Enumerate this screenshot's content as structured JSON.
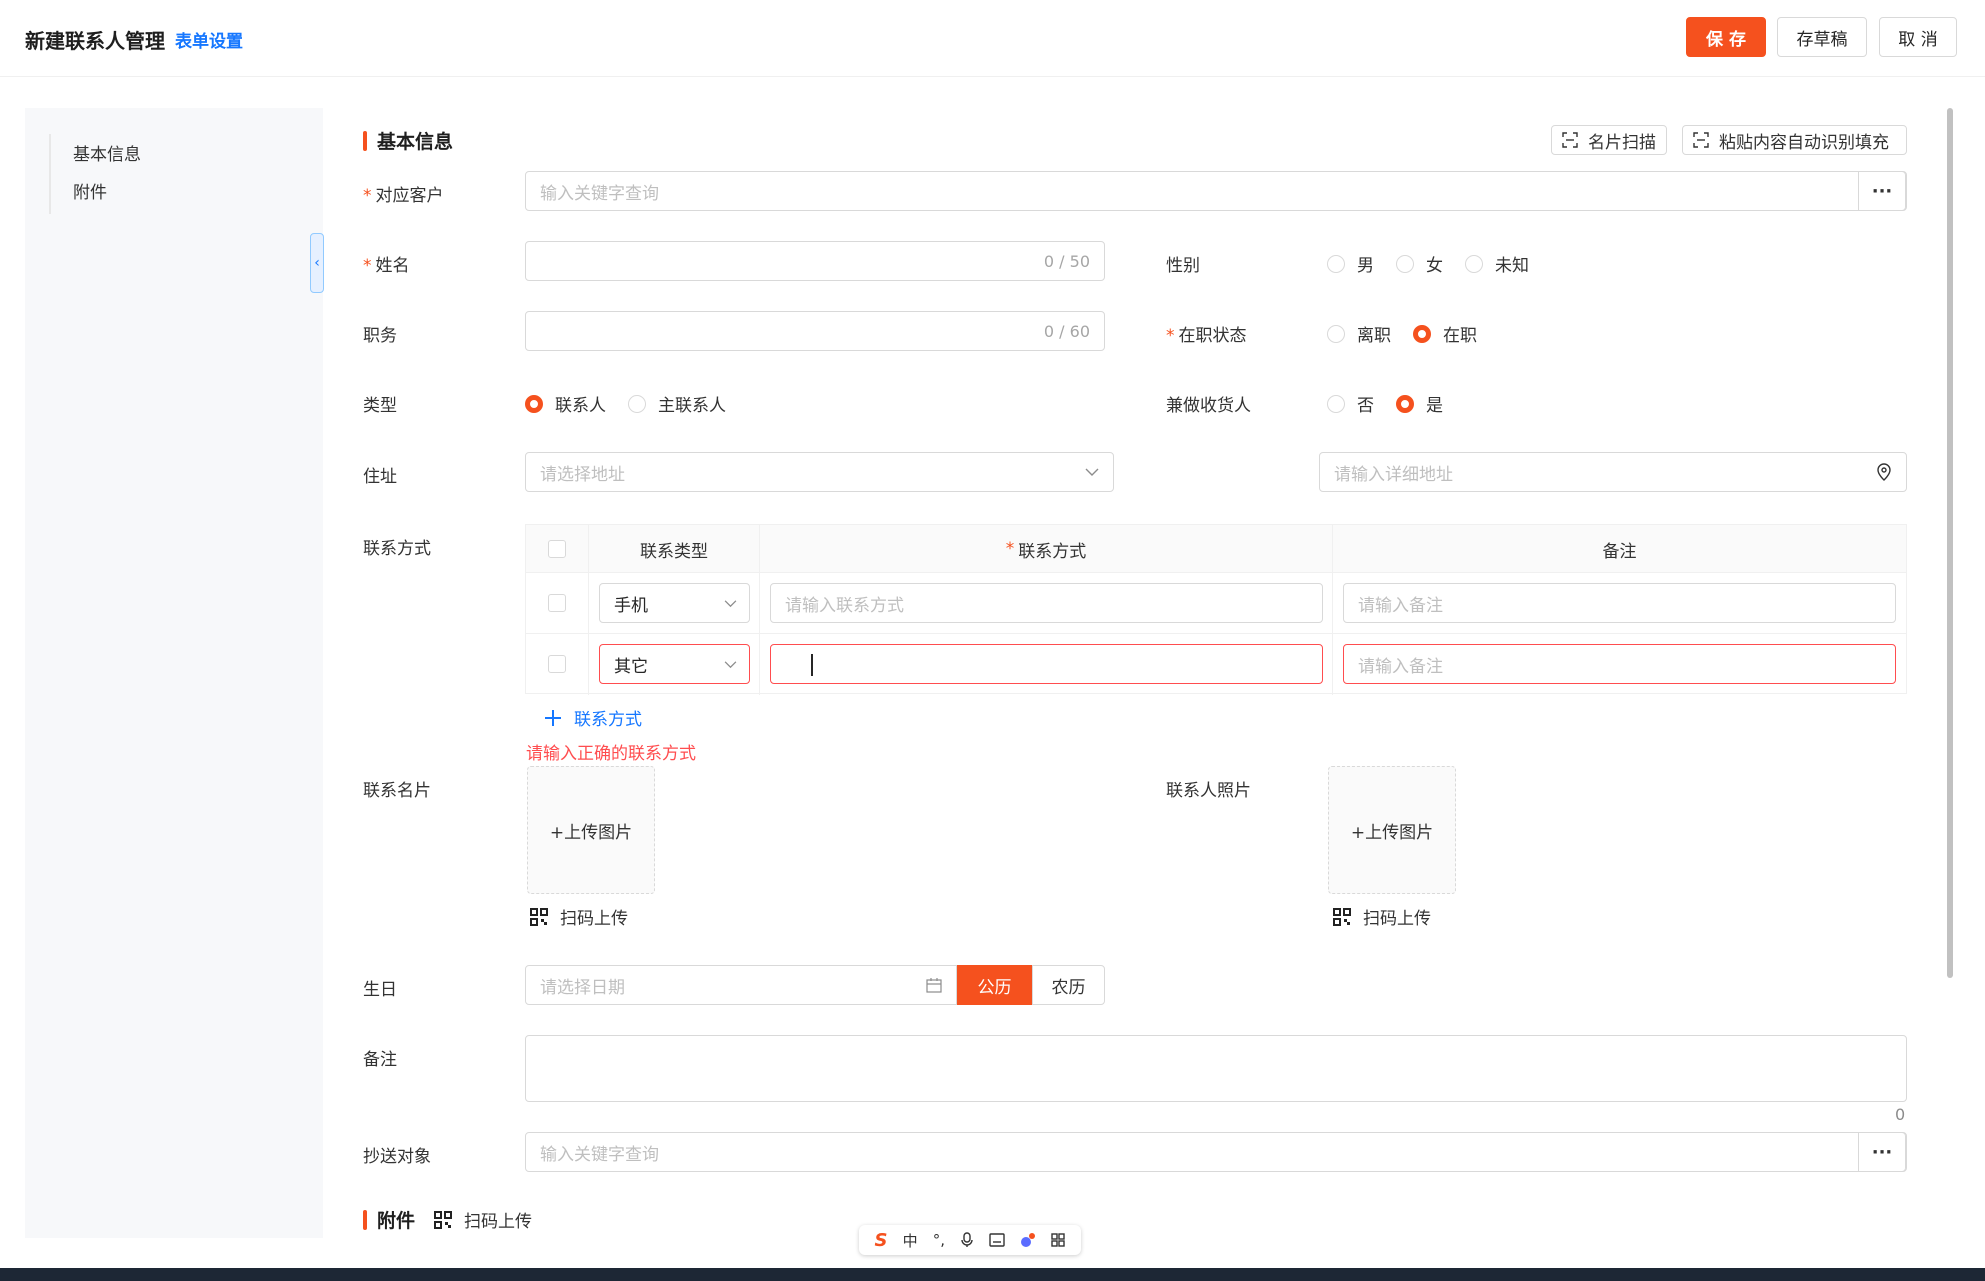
{
  "header": {
    "title": "新建联系人管理",
    "settings_link": "表单设置",
    "save_label": "保 存",
    "draft_label": "存草稿",
    "cancel_label": "取 消"
  },
  "sidenav": {
    "items": [
      {
        "label": "基本信息"
      },
      {
        "label": "附件"
      }
    ]
  },
  "collapse_icon": "‹",
  "section_basic": {
    "title": "基本信息",
    "card_scan_label": "名片扫描",
    "paste_recognize_label": "粘贴内容自动识别填充"
  },
  "form": {
    "customer": {
      "label": "对应客户",
      "placeholder": "输入关键字查询",
      "more": "···"
    },
    "name": {
      "label": "姓名",
      "counter": "0 / 50"
    },
    "gender": {
      "label": "性别",
      "options": [
        "男",
        "女",
        "未知"
      ],
      "selected": null
    },
    "position": {
      "label": "职务",
      "counter": "0 / 60"
    },
    "employment": {
      "label": "在职状态",
      "options": [
        "离职",
        "在职"
      ],
      "selected": "在职"
    },
    "type": {
      "label": "类型",
      "options": [
        "联系人",
        "主联系人"
      ],
      "selected": "联系人"
    },
    "receiver": {
      "label": "兼做收货人",
      "options": [
        "否",
        "是"
      ],
      "selected": "是"
    },
    "address": {
      "label": "住址",
      "region_placeholder": "请选择地址",
      "detail_placeholder": "请输入详细地址"
    },
    "contact": {
      "label": "联系方式",
      "columns": [
        "联系类型",
        "联系方式",
        "备注"
      ],
      "rows": [
        {
          "type": "手机",
          "value_placeholder": "请输入联系方式",
          "note_placeholder": "请输入备注",
          "error": false
        },
        {
          "type": "其它",
          "value_placeholder": "",
          "note_placeholder": "请输入备注",
          "error": true
        }
      ],
      "add_label": "联系方式",
      "error_message": "请输入正确的联系方式"
    },
    "card": {
      "label": "联系名片",
      "upload_label": "+上传图片",
      "scan_label": "扫码上传"
    },
    "photo": {
      "label": "联系人照片",
      "upload_label": "+上传图片",
      "scan_label": "扫码上传"
    },
    "birthday": {
      "label": "生日",
      "placeholder": "请选择日期",
      "calendar_solar": "公历",
      "calendar_lunar": "农历",
      "selected": "公历"
    },
    "remark": {
      "label": "备注",
      "count": "0"
    },
    "cc": {
      "label": "抄送对象",
      "placeholder": "输入关键字查询",
      "more": "···"
    }
  },
  "section_attach": {
    "title": "附件",
    "scan_label": "扫码上传"
  },
  "ime": {
    "logo": "S",
    "mode": "中",
    "punct": "°,",
    "icons": [
      "mic-icon",
      "keyboard-icon",
      "skin-icon",
      "grid-icon"
    ]
  },
  "colors": {
    "accent": "#f5511e",
    "link": "#1677ff",
    "error": "#ff4d4f"
  }
}
